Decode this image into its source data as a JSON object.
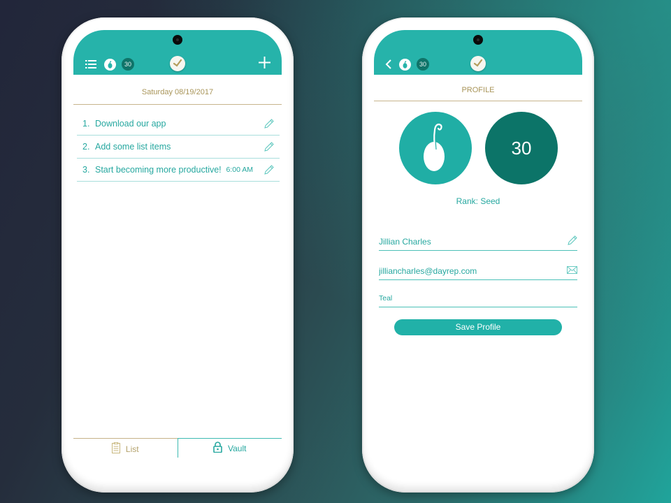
{
  "colors": {
    "primary_teal": "#26b3aa",
    "dark_teal": "#0c7468",
    "gold_text": "#a99559",
    "list_text": "#27a8a0"
  },
  "left_phone": {
    "topbar": {
      "menu_icon": "list-menu-icon",
      "seed_icon": "seed-icon",
      "points_badge": "30",
      "logo_icon": "clock-check-logo-icon",
      "add_icon": "plus-icon"
    },
    "date": "Saturday 08/19/2017",
    "todos": [
      {
        "number": "1.",
        "text": "Download our app",
        "time": ""
      },
      {
        "number": "2.",
        "text": "Add some list items",
        "time": ""
      },
      {
        "number": "3.",
        "text": "Start becoming more productive!",
        "time": "6:00 AM"
      }
    ],
    "tabs": [
      {
        "label": "List",
        "icon": "clipboard-icon",
        "active": false
      },
      {
        "label": "Vault",
        "icon": "lock-icon",
        "active": true
      }
    ]
  },
  "right_phone": {
    "topbar": {
      "back_icon": "chevron-left-icon",
      "seed_icon": "seed-icon",
      "points_badge": "30",
      "logo_icon": "clock-check-logo-icon"
    },
    "header": "PROFILE",
    "points": "30",
    "rank_label": "Rank: Seed",
    "fields": {
      "name": "Jillian Charles",
      "email": "jilliancharles@dayrep.com",
      "color": "Teal"
    },
    "save_label": "Save Profile"
  }
}
